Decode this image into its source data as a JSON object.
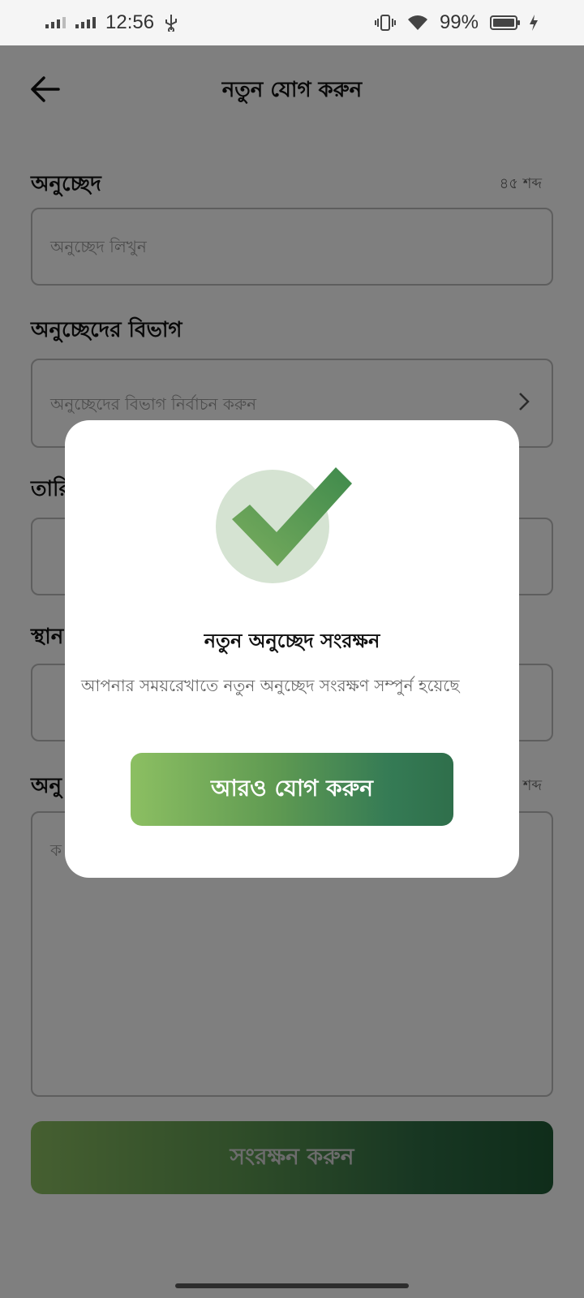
{
  "status_bar": {
    "time": "12:56",
    "battery": "99%"
  },
  "header": {
    "title": "নতুন যোগ করুন"
  },
  "form": {
    "paragraph_label": "অনুচ্ছেদ",
    "paragraph_counter": "৪৫ শব্দ",
    "paragraph_placeholder": "অনুচ্ছেদ লিখুন",
    "category_label": "অনুচ্ছেদের বিভাগ",
    "category_placeholder": "অনুচ্ছেদের বিভাগ নির্বাচন করুন",
    "date_label": "তারি",
    "place_label": "স্থান",
    "content_label": "অনু",
    "content_counter": "শব্দ",
    "content_placeholder": "ক",
    "save_button": "সংরক্ষন করুন"
  },
  "dialog": {
    "title": "নতুন অনুচ্ছেদ সংরক্ষন",
    "message": "আপনার সময়রেখাতে নতুন অনুচ্ছেদ সংরক্ষণ সম্পুর্ন হয়েছে",
    "add_more_button": "আরও যোগ করুন",
    "icon": "check-icon",
    "accent_color": "#5a9a52"
  }
}
